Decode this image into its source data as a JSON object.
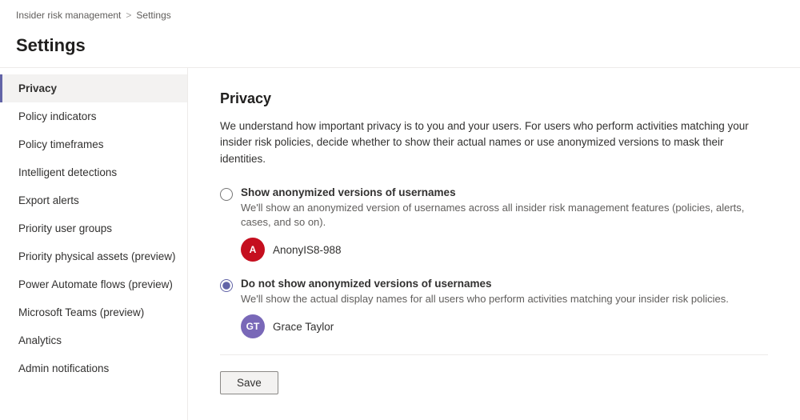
{
  "breadcrumb": {
    "parent": "Insider risk management",
    "separator": ">",
    "current": "Settings"
  },
  "page_title": "Settings",
  "sidebar": {
    "items": [
      {
        "id": "privacy",
        "label": "Privacy",
        "active": true
      },
      {
        "id": "policy-indicators",
        "label": "Policy indicators",
        "active": false
      },
      {
        "id": "policy-timeframes",
        "label": "Policy timeframes",
        "active": false
      },
      {
        "id": "intelligent-detections",
        "label": "Intelligent detections",
        "active": false
      },
      {
        "id": "export-alerts",
        "label": "Export alerts",
        "active": false
      },
      {
        "id": "priority-user-groups",
        "label": "Priority user groups",
        "active": false
      },
      {
        "id": "priority-physical-assets",
        "label": "Priority physical assets (preview)",
        "active": false
      },
      {
        "id": "power-automate-flows",
        "label": "Power Automate flows (preview)",
        "active": false
      },
      {
        "id": "microsoft-teams",
        "label": "Microsoft Teams (preview)",
        "active": false
      },
      {
        "id": "analytics",
        "label": "Analytics",
        "active": false
      },
      {
        "id": "admin-notifications",
        "label": "Admin notifications",
        "active": false
      }
    ]
  },
  "content": {
    "title": "Privacy",
    "description": "We understand how important privacy is to you and your users. For users who perform activities matching your insider risk policies, decide whether to show their actual names or use anonymized versions to mask their identities.",
    "option1": {
      "label": "Show anonymized versions of usernames",
      "description": "We'll show an anonymized version of usernames across all insider risk management features (policies, alerts, cases, and so on).",
      "example_user": "AnonyIS8-988",
      "avatar_initials": "A",
      "avatar_color": "red"
    },
    "option2": {
      "label": "Do not show anonymized versions of usernames",
      "description": "We'll show the actual display names for all users who perform activities matching your insider risk policies.",
      "example_user": "Grace Taylor",
      "avatar_initials": "GT",
      "avatar_color": "purple"
    },
    "save_button": "Save"
  }
}
